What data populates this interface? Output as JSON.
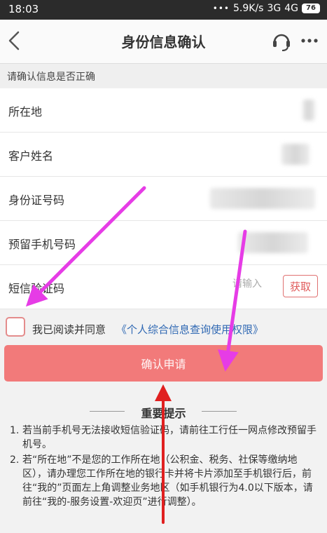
{
  "statusbar": {
    "time": "18:03",
    "speed": "5.9K/s",
    "network1": "3G",
    "network2": "4G",
    "battery": "76"
  },
  "navbar": {
    "title": "身份信息确认"
  },
  "hint": "请确认信息是否正确",
  "form": {
    "location_label": "所在地",
    "name_label": "客户姓名",
    "id_label": "身份证号码",
    "phone_label": "预留手机号码",
    "code_label": "短信验证码",
    "code_placeholder": "请输入",
    "get_code_label": "获取"
  },
  "agree": {
    "text": "我已阅读并同意",
    "link": "《个人综合信息查询使用权限》"
  },
  "submit_label": "确认申请",
  "notice": {
    "title": "重要提示",
    "items": [
      {
        "num": "1.",
        "text": "若当前手机号无法接收短信验证码，请前往工行任一网点修改预留手机号。"
      },
      {
        "num": "2.",
        "text": "若“所在地”不是您的工作所在地（公积金、税务、社保等缴纳地区），请办理您工作所在地的银行卡并将卡片添加至手机银行后，前往“我的”页面左上角调整业务地区（如手机银行为4.0以下版本，请前往“我的-服务设置-欢迎页”进行调整）。"
      }
    ]
  },
  "colors": {
    "accent": "#f27a7a",
    "link": "#2f68b3",
    "annotation_arrow_magenta": "#e63ce6",
    "annotation_arrow_red": "#e02020"
  }
}
